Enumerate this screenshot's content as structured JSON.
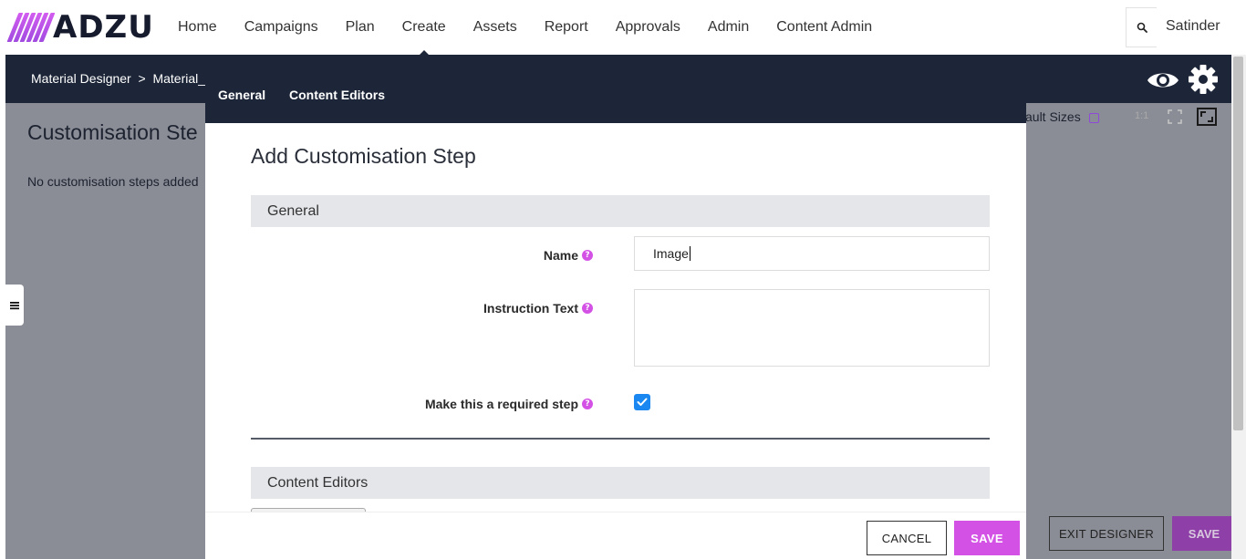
{
  "brand": {
    "name": "ADZU"
  },
  "nav": {
    "items": [
      "Home",
      "Campaigns",
      "Plan",
      "Create",
      "Assets",
      "Report",
      "Approvals",
      "Admin",
      "Content Admin"
    ],
    "active": "Create"
  },
  "user": {
    "name": "Satinder"
  },
  "designer": {
    "breadcrumb": "Material Designer  >  Material_T",
    "title": "Customisation Ste",
    "empty_text": "No customisation steps added",
    "default_sizes_label": "ault Sizes",
    "ratio_label": "1:1",
    "exit_label": "EXIT DESIGNER",
    "save_label": "SAVE"
  },
  "modal": {
    "tabs": [
      "General",
      "Content Editors"
    ],
    "title": "Add Customisation Step",
    "section_general": "General",
    "name_label": "Name",
    "name_value": "Image",
    "instruction_label": "Instruction Text",
    "instruction_value": "",
    "required_label": "Make this a required step",
    "required_checked": true,
    "section_content_editors": "Content Editors",
    "cancel_label": "CANCEL",
    "save_label": "SAVE"
  },
  "icons": {
    "help": "?",
    "colors": {
      "accent": "#d451e6",
      "dark": "#1d2638",
      "checkbox": "#1a88f0"
    }
  }
}
